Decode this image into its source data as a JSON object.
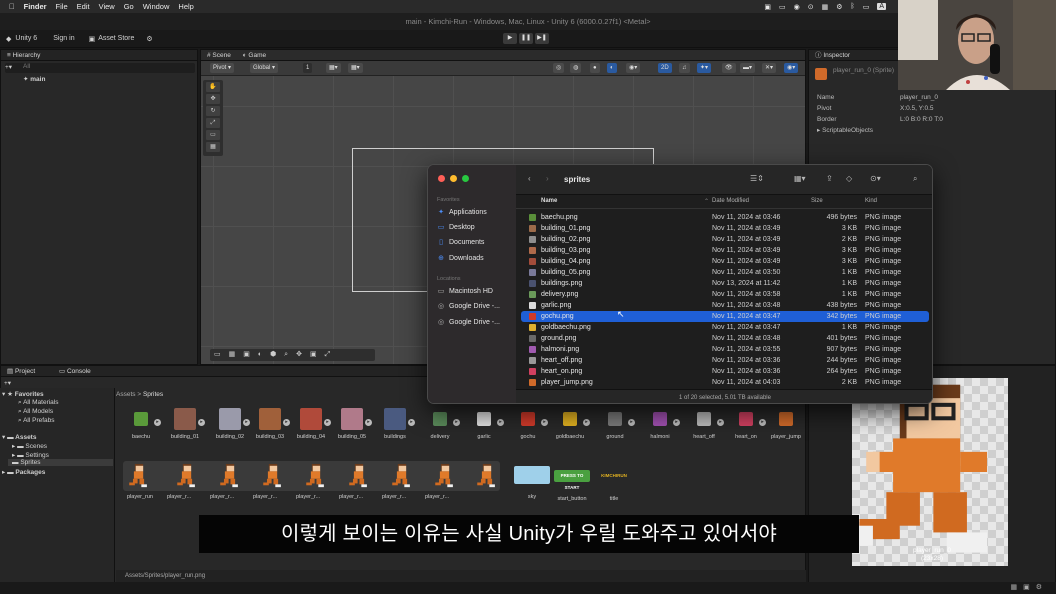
{
  "menubar": {
    "app": "Finder",
    "items": [
      "File",
      "Edit",
      "View",
      "Go",
      "Window",
      "Help"
    ],
    "right_badge": "A"
  },
  "window_title": "main - Kimchi-Run - Windows, Mac, Linux - Unity 6 (6000.0.27f1) <Metal>",
  "toolbar": {
    "unity": "Unity 6",
    "sign_in": "Sign in",
    "asset_store": "Asset Store"
  },
  "hierarchy": {
    "tab": "Hierarchy",
    "search": "All",
    "scene": "main"
  },
  "scene": {
    "tab_scene": "Scene",
    "tab_game": "Game",
    "pivot": "Pivot",
    "global": "Global",
    "num": "1",
    "mode2d": "2D"
  },
  "inspector": {
    "tab": "Inspector",
    "object": "player_run_0 (Sprite)",
    "rows": [
      {
        "k": "Name",
        "v": "player_run_0"
      },
      {
        "k": "Pivot",
        "v": "X:0.5, Y:0.5"
      },
      {
        "k": "Border",
        "v": "L:0 B:0 R:0 T:0"
      }
    ],
    "scriptable": "ScriptableObjects"
  },
  "finder": {
    "title": "sprites",
    "favorites_label": "Favorites",
    "locations_label": "Locations",
    "favorites": [
      "Applications",
      "Desktop",
      "Documents",
      "Downloads"
    ],
    "locations": [
      "Macintosh HD",
      "Google Drive -...",
      "Google Drive -..."
    ],
    "cols": {
      "name": "Name",
      "date": "Date Modified",
      "size": "Size",
      "kind": "Kind"
    },
    "files": [
      {
        "name": "baechu.png",
        "date": "Nov 11, 2024 at 03:46",
        "size": "496 bytes",
        "kind": "PNG image",
        "color": "#5a8f3a"
      },
      {
        "name": "building_01.png",
        "date": "Nov 11, 2024 at 03:49",
        "size": "3 KB",
        "kind": "PNG image",
        "color": "#9c6b4a"
      },
      {
        "name": "building_02.png",
        "date": "Nov 11, 2024 at 03:49",
        "size": "2 KB",
        "kind": "PNG image",
        "color": "#8e8e8e"
      },
      {
        "name": "building_03.png",
        "date": "Nov 11, 2024 at 03:49",
        "size": "3 KB",
        "kind": "PNG image",
        "color": "#b06a4a"
      },
      {
        "name": "building_04.png",
        "date": "Nov 11, 2024 at 03:49",
        "size": "3 KB",
        "kind": "PNG image",
        "color": "#a34c3a"
      },
      {
        "name": "building_05.png",
        "date": "Nov 11, 2024 at 03:50",
        "size": "1 KB",
        "kind": "PNG image",
        "color": "#7a7a9a"
      },
      {
        "name": "buildings.png",
        "date": "Nov 13, 2024 at 11:42",
        "size": "1 KB",
        "kind": "PNG image",
        "color": "#4a5270"
      },
      {
        "name": "delivery.png",
        "date": "Nov 11, 2024 at 03:58",
        "size": "1 KB",
        "kind": "PNG image",
        "color": "#6a9a5a"
      },
      {
        "name": "garlic.png",
        "date": "Nov 11, 2024 at 03:48",
        "size": "438 bytes",
        "kind": "PNG image",
        "color": "#dcdcdc"
      },
      {
        "name": "gochu.png",
        "date": "Nov 11, 2024 at 03:47",
        "size": "342 bytes",
        "kind": "PNG image",
        "color": "#d03a2a",
        "selected": true
      },
      {
        "name": "goldbaechu.png",
        "date": "Nov 11, 2024 at 03:47",
        "size": "1 KB",
        "kind": "PNG image",
        "color": "#e0b030"
      },
      {
        "name": "ground.png",
        "date": "Nov 11, 2024 at 03:48",
        "size": "401 bytes",
        "kind": "PNG image",
        "color": "#6a6a6a"
      },
      {
        "name": "halmoni.png",
        "date": "Nov 11, 2024 at 03:55",
        "size": "907 bytes",
        "kind": "PNG image",
        "color": "#a05ab0"
      },
      {
        "name": "heart_off.png",
        "date": "Nov 11, 2024 at 03:36",
        "size": "244 bytes",
        "kind": "PNG image",
        "color": "#999"
      },
      {
        "name": "heart_on.png",
        "date": "Nov 11, 2024 at 03:36",
        "size": "264 bytes",
        "kind": "PNG image",
        "color": "#d04060"
      },
      {
        "name": "player_jump.png",
        "date": "Nov 11, 2024 at 04:03",
        "size": "2 KB",
        "kind": "PNG image",
        "color": "#d06a2a"
      }
    ],
    "status": "1 of 20 selected, 5.01 TB available"
  },
  "project": {
    "tab": "Project",
    "tab_console": "Console",
    "breadcrumb_root": "Assets",
    "breadcrumb_leaf": "Sprites",
    "favorites": "Favorites",
    "fav_items": [
      "All Materials",
      "All Models",
      "All Prefabs"
    ],
    "assets": "Assets",
    "asset_items": [
      "Scenes",
      "Settings",
      "Sprites"
    ],
    "packages": "Packages",
    "row1": [
      {
        "label": "baechu",
        "color": "#5a9a3a"
      },
      {
        "label": "building_01",
        "color": "#8a5a4a"
      },
      {
        "label": "building_02",
        "color": "#9a9aaa"
      },
      {
        "label": "building_03",
        "color": "#a0603a"
      },
      {
        "label": "building_04",
        "color": "#b04a3a"
      },
      {
        "label": "building_05",
        "color": "#b07a8a"
      },
      {
        "label": "buildings",
        "color": "#4a5a80"
      },
      {
        "label": "delivery",
        "color": "#5a8a5a"
      },
      {
        "label": "garlic",
        "color": "#e0e0e0"
      },
      {
        "label": "gochu",
        "color": "#d03a2a"
      },
      {
        "label": "goldbaechu",
        "color": "#e0b020"
      },
      {
        "label": "ground",
        "color": "#7a7a7a"
      },
      {
        "label": "halmoni",
        "color": "#a050b0"
      },
      {
        "label": "heart_off",
        "color": "#bbbbbb"
      },
      {
        "label": "heart_on",
        "color": "#d04060"
      },
      {
        "label": "player_jump",
        "color": "#d06a2a"
      }
    ],
    "run_labels": [
      "player_run",
      "player_r...",
      "player_r...",
      "player_r...",
      "player_r...",
      "player_r...",
      "player_r...",
      "player_r..."
    ],
    "row2b": [
      {
        "label": "sky",
        "color": "#9fd0ea"
      },
      {
        "label": "start_button",
        "color": "#4aa040"
      },
      {
        "label": "title",
        "color": "#e0b020",
        "text": "KIMCHIRUN"
      }
    ],
    "start_text": "PRESS TO START",
    "path": "Assets/Sprites/player_run.png"
  },
  "preview": {
    "name": "player_run_0",
    "dims": "(23x28)"
  },
  "subtitle": "이렇게 보이는 이유는 사실 Unity가 우릴 도와주고 있어서야"
}
